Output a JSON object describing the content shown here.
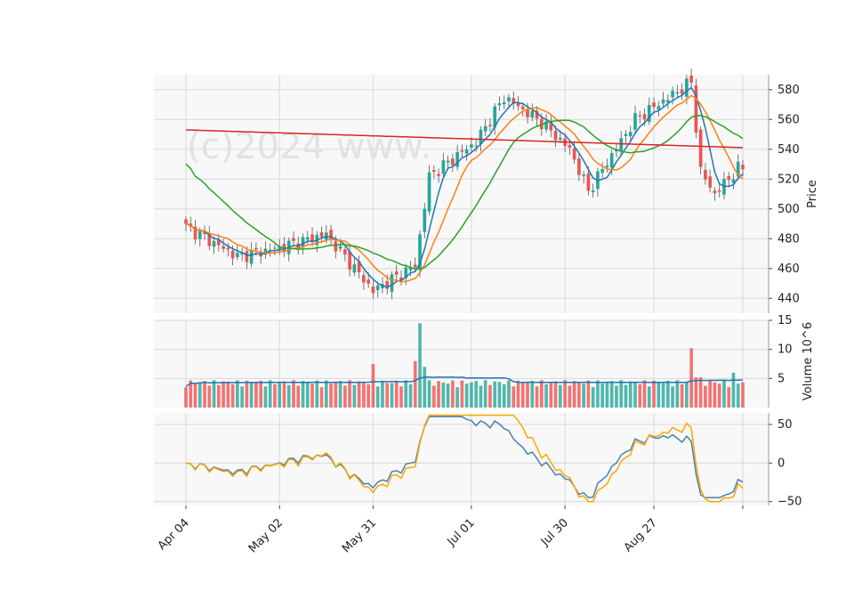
{
  "chart_data": {
    "type": "candlestick",
    "watermark": "(c)2024 www.",
    "x_tick_labels": [
      "Apr 04",
      "May 02",
      "May 31",
      "Jul 01",
      "Jul 30",
      "Aug 27"
    ],
    "panels": {
      "price": {
        "ylabel": "Price",
        "ylim": [
          430,
          590
        ],
        "yticks": [
          440,
          460,
          480,
          500,
          520,
          540,
          560,
          580
        ],
        "key_closes": [
          {
            "date": "Apr 04",
            "close": 488
          },
          {
            "date": "Apr 19",
            "close": 468
          },
          {
            "date": "May 02",
            "close": 474
          },
          {
            "date": "May 17",
            "close": 483
          },
          {
            "date": "May 31",
            "close": 445
          },
          {
            "date": "Jun 13",
            "close": 462
          },
          {
            "date": "Jun 18",
            "close": 522
          },
          {
            "date": "Jul 01",
            "close": 545
          },
          {
            "date": "Jul 10",
            "close": 575
          },
          {
            "date": "Jul 22",
            "close": 558
          },
          {
            "date": "Jul 30",
            "close": 540
          },
          {
            "date": "Aug 05",
            "close": 512
          },
          {
            "date": "Aug 20",
            "close": 560
          },
          {
            "date": "Sep 06",
            "close": 585
          },
          {
            "date": "Sep 09",
            "close": 525
          },
          {
            "date": "Sep 13",
            "close": 510
          },
          {
            "date": "Sep 20",
            "close": 527
          }
        ],
        "moving_averages": [
          {
            "color": "#1f77b4"
          },
          {
            "color": "#ff7f0e"
          },
          {
            "color": "#2ca02c"
          },
          {
            "color": "#d62728"
          }
        ]
      },
      "volume": {
        "ylabel": "Volume  10^6",
        "ylim": [
          0,
          15
        ],
        "yticks": [
          5,
          10,
          15
        ],
        "peak": 14.5,
        "baseline": 3.5
      },
      "oscillator": {
        "ylim": [
          -55,
          65
        ],
        "yticks": [
          -50,
          0,
          50
        ],
        "series": [
          {
            "color": "#4682b4"
          },
          {
            "color": "#ffa500"
          }
        ]
      }
    },
    "grid": true,
    "up_color": "#26a69a",
    "down_color": "#ef5350"
  }
}
